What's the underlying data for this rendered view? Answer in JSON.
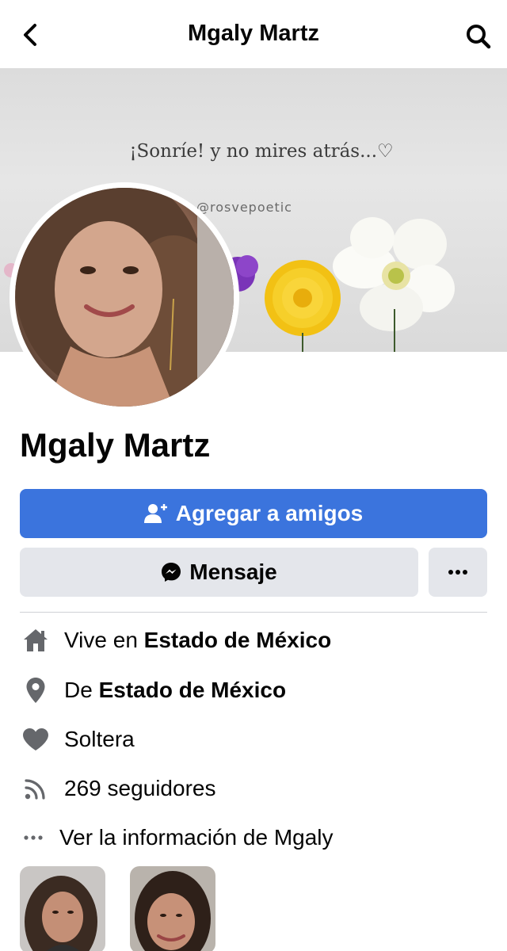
{
  "header": {
    "title": "Mgaly Martz"
  },
  "cover": {
    "quote": "¡Sonríe! y no mires atrás...♡",
    "handle": "@rosvepoetic"
  },
  "profile": {
    "name": "Mgaly Martz"
  },
  "actions": {
    "add_friend_label": "Agregar a amigos",
    "message_label": "Mensaje"
  },
  "info": {
    "lives_prefix": "Vive en ",
    "lives_place": "Estado de México",
    "from_prefix": "De ",
    "from_place": "Estado de México",
    "relationship": "Soltera",
    "followers": "269 seguidores",
    "see_info": "Ver la información de Mgaly"
  },
  "colors": {
    "primary_button": "#3b74dd",
    "secondary_button": "#e4e6eb",
    "icon_gray": "#65676b"
  },
  "icons": {
    "back": "chevron-left-icon",
    "search": "search-icon",
    "add_friend": "add-person-icon",
    "message": "messenger-icon",
    "more": "ellipsis-icon",
    "lives": "home-icon",
    "from": "location-pin-icon",
    "relationship": "heart-icon",
    "followers": "rss-feed-icon",
    "see_info": "ellipsis-icon"
  }
}
